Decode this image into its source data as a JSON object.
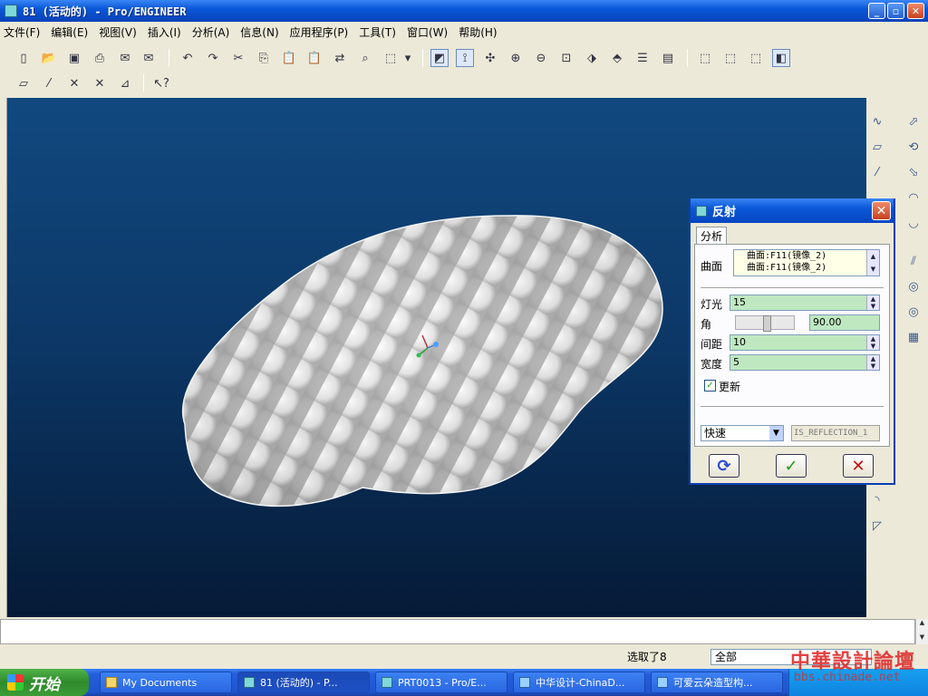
{
  "window": {
    "title": "81 (活动的) - Pro/ENGINEER",
    "min": "_",
    "max": "▫",
    "close": "✕"
  },
  "menu": [
    "文件(F)",
    "编辑(E)",
    "视图(V)",
    "插入(I)",
    "分析(A)",
    "信息(N)",
    "应用程序(P)",
    "工具(T)",
    "窗口(W)",
    "帮助(H)"
  ],
  "dialog": {
    "title": "反射",
    "tab": "分析",
    "surface_label": "曲面",
    "surfaces": [
      "曲面:F11(镜像_2)",
      "曲面:F11(镜像_2)"
    ],
    "light_label": "灯光",
    "light_value": "15",
    "angle_label": "角",
    "angle_value": "90.00",
    "spacing_label": "间距",
    "spacing_value": "10",
    "width_label": "宽度",
    "width_value": "5",
    "update_label": "更新",
    "update_checked": true,
    "mode_value": "快速",
    "name_value": "IS_REFLECTION_1"
  },
  "status": {
    "selected": "选取了8",
    "filter": "全部"
  },
  "taskbar": {
    "start": "开始",
    "tasks": [
      "My Documents",
      "81 (活动的) - P...",
      "PRT0013 - Pro/E...",
      "中华设计-ChinaD...",
      "可爱云朵造型构..."
    ]
  },
  "watermark": {
    "line1": "中華設計論壇",
    "line2": "bbs.chinade.net"
  },
  "colors": {
    "viewport_top": "#11497f",
    "viewport_bottom": "#051a36",
    "titlebar": "#0a57d8",
    "field_green": "#bfe8c0"
  }
}
